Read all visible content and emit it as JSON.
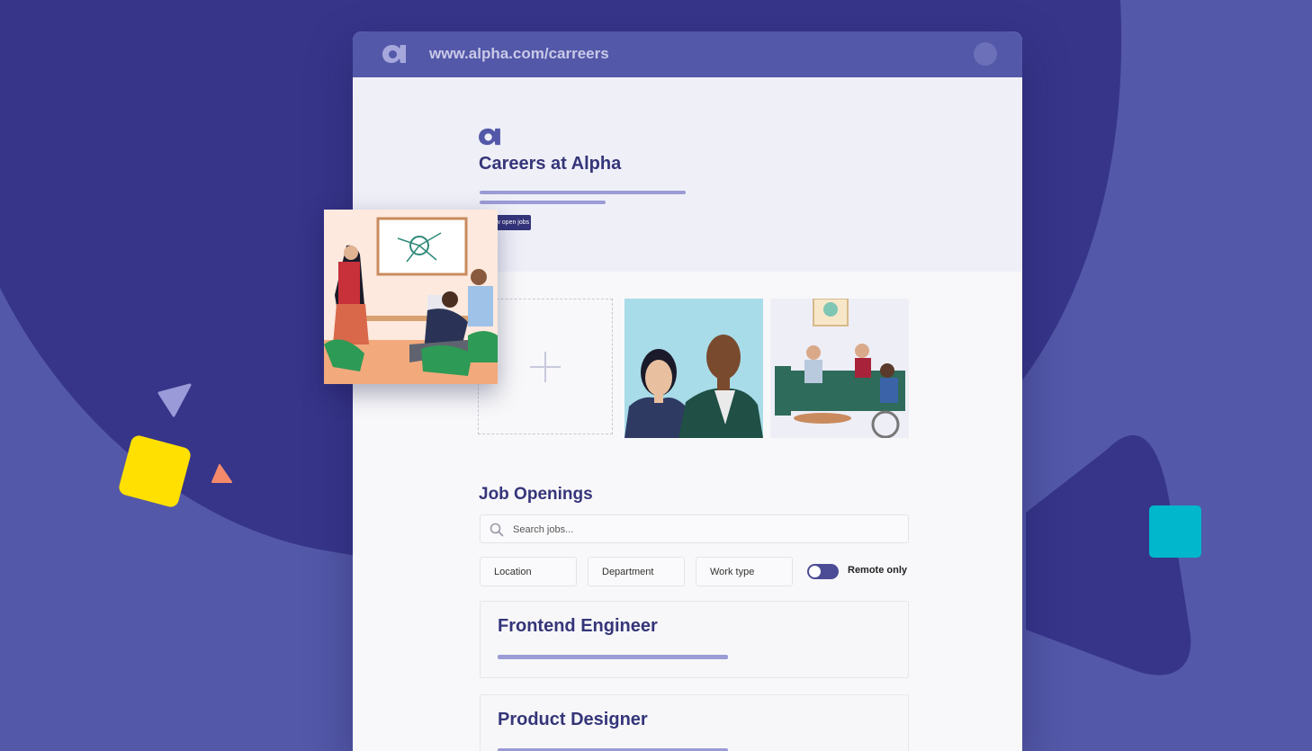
{
  "browser": {
    "url": "www.alpha.com/carreers"
  },
  "hero": {
    "title": "Careers at Alpha",
    "badge": "view open jobs"
  },
  "jobs_section": {
    "title": "Job Openings",
    "search_placeholder": "Search jobs...",
    "filters": [
      "Location",
      "Department",
      "Work type"
    ],
    "remote_toggle_label": "Remote only",
    "remote_toggle_on": true
  },
  "job_listings": [
    {
      "title": "Frontend Engineer"
    },
    {
      "title": "Product Designer"
    }
  ],
  "colors": {
    "accent": "#35357a",
    "background": "#5358a8",
    "bar": "#9b9bd6",
    "yellow": "#ffe000",
    "cyan": "#00b7cc"
  },
  "icons": [
    "alpha-logo-icon",
    "search-icon",
    "plus-icon"
  ]
}
